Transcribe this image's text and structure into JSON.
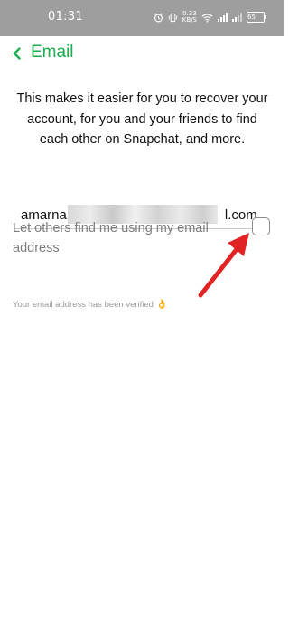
{
  "status_bar": {
    "time": "01:31",
    "net_speed_value": "0.33",
    "net_speed_unit": "KB/S",
    "battery_level": "65"
  },
  "header": {
    "title": "Email",
    "back_icon": "chevron-left-icon"
  },
  "description": "This makes it easier for you to recover your account, for you and your friends to find each other on Snapchat, and more.",
  "email": {
    "visible_prefix": "amarna",
    "visible_suffix": "l.com",
    "display_value": "amarna                                          l.com"
  },
  "find_me": {
    "label": "Let others find me using my email address",
    "checked": false
  },
  "verified": {
    "text": "Your email address has been verified",
    "icon": "ok-hand-icon"
  },
  "colors": {
    "accent": "#1cae4e",
    "status_bar": "#9e9e9e",
    "annotation_arrow": "#e02424"
  }
}
